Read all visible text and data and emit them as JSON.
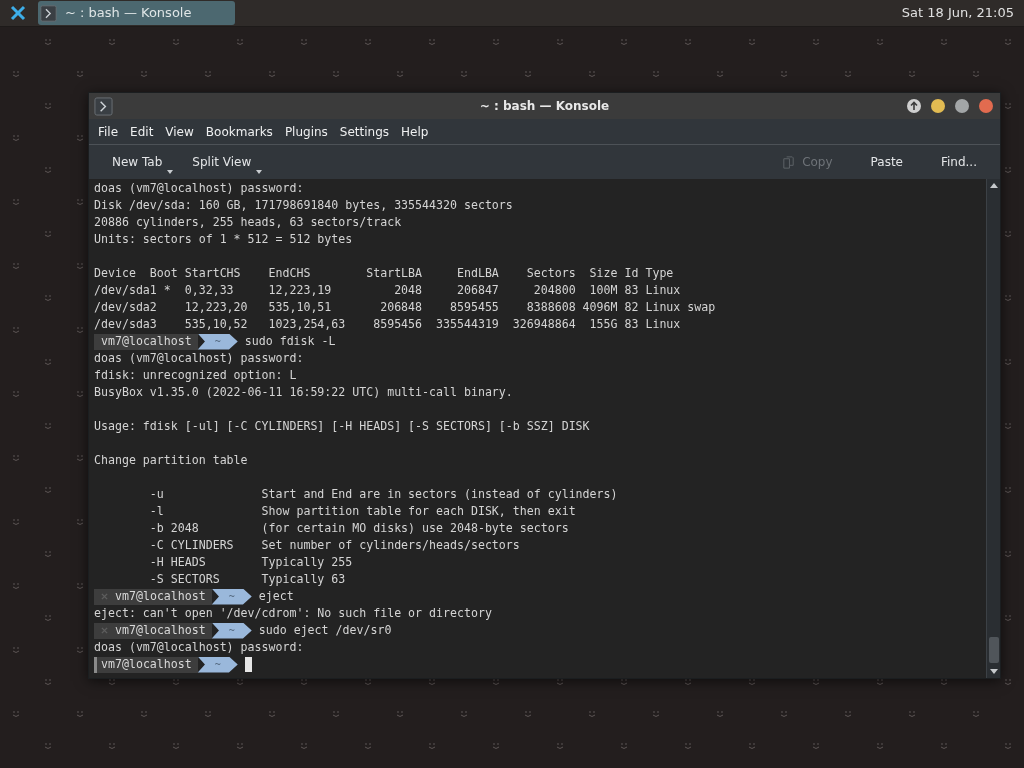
{
  "panel": {
    "task": {
      "title": "~ : bash — Konsole"
    },
    "clock": "Sat 18 Jun, 21:05"
  },
  "window": {
    "title": "~ : bash — Konsole"
  },
  "menu": [
    "File",
    "Edit",
    "View",
    "Bookmarks",
    "Plugins",
    "Settings",
    "Help"
  ],
  "toolbar": [
    {
      "label": "New Tab",
      "kind": "dropdown",
      "disabled": false
    },
    {
      "label": "Split View",
      "kind": "dropdown",
      "disabled": false
    },
    {
      "label": "Copy",
      "kind": "copy",
      "disabled": true
    },
    {
      "label": "Paste",
      "kind": "plain",
      "disabled": false
    },
    {
      "label": "Find...",
      "kind": "plain",
      "disabled": false
    }
  ],
  "terminal": {
    "lines": [
      {
        "kind": "text",
        "text": "doas (vm7@localhost) password:"
      },
      {
        "kind": "text",
        "text": "Disk /dev/sda: 160 GB, 171798691840 bytes, 335544320 sectors"
      },
      {
        "kind": "text",
        "text": "20886 cylinders, 255 heads, 63 sectors/track"
      },
      {
        "kind": "text",
        "text": "Units: sectors of 1 * 512 = 512 bytes"
      },
      {
        "kind": "blank"
      },
      {
        "kind": "text",
        "text": "Device  Boot StartCHS    EndCHS        StartLBA     EndLBA    Sectors  Size Id Type"
      },
      {
        "kind": "text",
        "text": "/dev/sda1 *  0,32,33     12,223,19         2048     206847     204800  100M 83 Linux"
      },
      {
        "kind": "text",
        "text": "/dev/sda2    12,223,20   535,10,51       206848    8595455    8388608 4096M 82 Linux swap"
      },
      {
        "kind": "text",
        "text": "/dev/sda3    535,10,52   1023,254,63    8595456  335544319  326948864  155G 83 Linux"
      },
      {
        "kind": "prompt",
        "host": "vm7@localhost",
        "dir": "~",
        "command": "sudo fdisk -L",
        "error": false,
        "cursor": false
      },
      {
        "kind": "text",
        "text": "doas (vm7@localhost) password:"
      },
      {
        "kind": "text",
        "text": "fdisk: unrecognized option: L"
      },
      {
        "kind": "text",
        "text": "BusyBox v1.35.0 (2022-06-11 16:59:22 UTC) multi-call binary."
      },
      {
        "kind": "blank"
      },
      {
        "kind": "text",
        "text": "Usage: fdisk [-ul] [-C CYLINDERS] [-H HEADS] [-S SECTORS] [-b SSZ] DISK"
      },
      {
        "kind": "blank"
      },
      {
        "kind": "text",
        "text": "Change partition table"
      },
      {
        "kind": "blank"
      },
      {
        "kind": "text",
        "text": "        -u              Start and End are in sectors (instead of cylinders)"
      },
      {
        "kind": "text",
        "text": "        -l              Show partition table for each DISK, then exit"
      },
      {
        "kind": "text",
        "text": "        -b 2048         (for certain MO disks) use 2048-byte sectors"
      },
      {
        "kind": "text",
        "text": "        -C CYLINDERS    Set number of cylinders/heads/sectors"
      },
      {
        "kind": "text",
        "text": "        -H HEADS        Typically 255"
      },
      {
        "kind": "text",
        "text": "        -S SECTORS      Typically 63"
      },
      {
        "kind": "prompt",
        "host": "vm7@localhost",
        "dir": "~",
        "command": "eject",
        "error": true,
        "cursor": false
      },
      {
        "kind": "text",
        "text": "eject: can't open '/dev/cdrom': No such file or directory"
      },
      {
        "kind": "prompt",
        "host": "vm7@localhost",
        "dir": "~",
        "command": "sudo eject /dev/sr0",
        "error": true,
        "cursor": false
      },
      {
        "kind": "text",
        "text": "doas (vm7@localhost) password:"
      },
      {
        "kind": "prompt",
        "host": "vm7@localhost",
        "dir": "~",
        "error": false,
        "cursor": true
      }
    ]
  }
}
